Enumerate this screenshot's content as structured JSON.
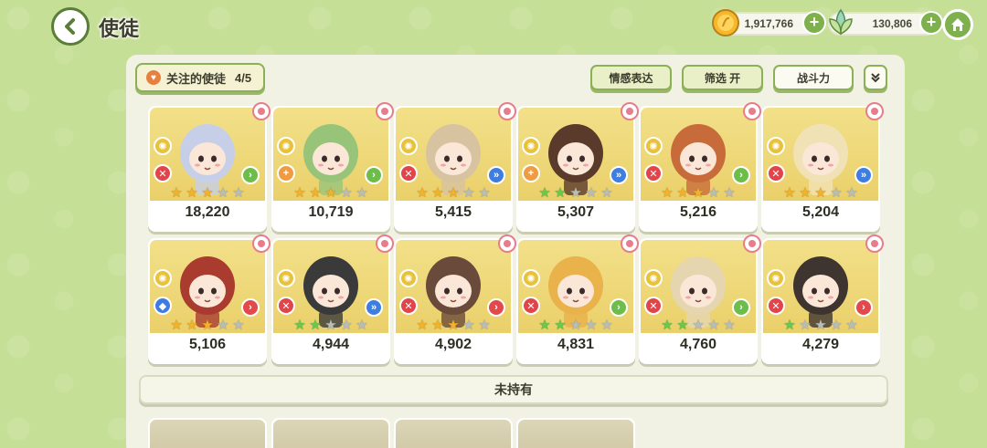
{
  "header": {
    "title": "使徒",
    "gold": "1,917,766",
    "crystal": "130,806",
    "plus": "+"
  },
  "toolbar": {
    "favorite_label": "关注的使徒",
    "favorite_count": "4/5",
    "emotion_label": "情感表达",
    "filter_label": "筛选 开",
    "power_label": "战斗力",
    "collapse_label": "»"
  },
  "cards": [
    {
      "power": "18,220",
      "role": "atk",
      "arrow": "green",
      "stars": [
        "gold",
        "gold",
        "gold",
        "gray",
        "gray"
      ],
      "hair": "#c7cfe8"
    },
    {
      "power": "10,719",
      "role": "sup",
      "arrow": "green",
      "stars": [
        "gold",
        "gold",
        "gold",
        "gray",
        "gray"
      ],
      "hair": "#98c47a"
    },
    {
      "power": "5,415",
      "role": "atk",
      "arrow": "blue",
      "stars": [
        "gold",
        "gold",
        "gold",
        "gray",
        "gray"
      ],
      "hair": "#d8c3a1"
    },
    {
      "power": "5,307",
      "role": "sup",
      "arrow": "blue",
      "stars": [
        "green",
        "green",
        "gray",
        "gray",
        "gray"
      ],
      "hair": "#5a3a2a"
    },
    {
      "power": "5,216",
      "role": "atk",
      "arrow": "green",
      "stars": [
        "gold",
        "gold",
        "gold",
        "gray",
        "gray"
      ],
      "hair": "#c86b3a"
    },
    {
      "power": "5,204",
      "role": "atk",
      "arrow": "blue",
      "stars": [
        "gold",
        "gold",
        "gold",
        "gray",
        "gray"
      ],
      "hair": "#f1e2b5"
    },
    {
      "power": "5,106",
      "role": "def",
      "arrow": "red",
      "stars": [
        "gold",
        "gold",
        "gold",
        "gray",
        "gray"
      ],
      "hair": "#a93b2f"
    },
    {
      "power": "4,944",
      "role": "atk",
      "arrow": "blue",
      "stars": [
        "green",
        "green",
        "gray",
        "gray",
        "gray"
      ],
      "hair": "#3a3a3a"
    },
    {
      "power": "4,902",
      "role": "atk",
      "arrow": "red",
      "stars": [
        "gold",
        "gold",
        "gold",
        "gray",
        "gray"
      ],
      "hair": "#6a4a3a"
    },
    {
      "power": "4,831",
      "role": "atk",
      "arrow": "green",
      "stars": [
        "green",
        "green",
        "gray",
        "gray",
        "gray"
      ],
      "hair": "#e9b24a"
    },
    {
      "power": "4,760",
      "role": "atk",
      "arrow": "green",
      "stars": [
        "green",
        "green",
        "gray",
        "gray",
        "gray"
      ],
      "hair": "#e6d6b0"
    },
    {
      "power": "4,279",
      "role": "atk",
      "arrow": "red",
      "stars": [
        "green",
        "gray",
        "gray",
        "gray",
        "gray"
      ],
      "hair": "#3e3430"
    }
  ],
  "not_owned_label": "未持有",
  "locked_cards": 4
}
